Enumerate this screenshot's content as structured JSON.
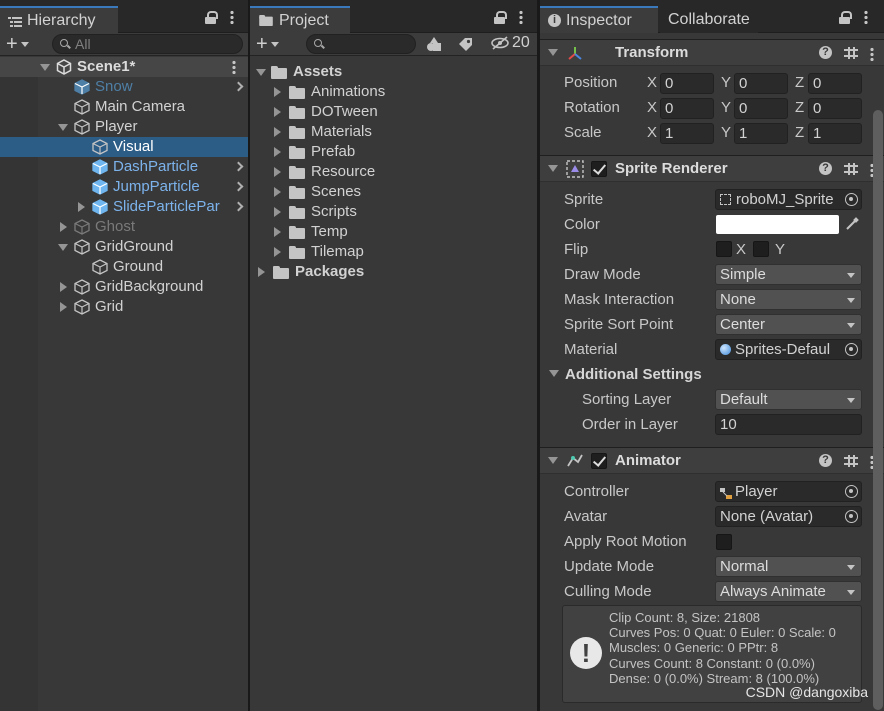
{
  "hierarchy": {
    "tab_label": "Hierarchy",
    "search_placeholder": "All",
    "items": [
      {
        "label": "Scene1*",
        "color": "#dcdcdc"
      },
      {
        "label": "Snow",
        "color": "#4e7fa6"
      },
      {
        "label": "Main Camera",
        "color": "#d2d2d2"
      },
      {
        "label": "Player",
        "color": "#d2d2d2"
      },
      {
        "label": "Visual",
        "color": "#ffffff"
      },
      {
        "label": "DashParticle",
        "color": "#7cb3ec"
      },
      {
        "label": "JumpParticle",
        "color": "#7cb3ec"
      },
      {
        "label": "SlideParticlePar",
        "color": "#7cb3ec"
      },
      {
        "label": "Ghost",
        "color": "#7a7a7a"
      },
      {
        "label": "GridGround",
        "color": "#d2d2d2"
      },
      {
        "label": "Ground",
        "color": "#d2d2d2"
      },
      {
        "label": "GridBackground",
        "color": "#d2d2d2"
      },
      {
        "label": "Grid",
        "color": "#d2d2d2"
      }
    ]
  },
  "project": {
    "tab_label": "Project",
    "hidden_count": "20",
    "root": "Assets",
    "folders": [
      "Animations",
      "DOTween",
      "Materials",
      "Prefab",
      "Resource",
      "Scenes",
      "Scripts",
      "Temp",
      "Tilemap"
    ],
    "packages": "Packages"
  },
  "inspector": {
    "tab_label": "Inspector",
    "tab2_label": "Collaborate",
    "transform": {
      "title": "Transform",
      "rows": [
        {
          "label": "Position",
          "x": "0",
          "y": "0",
          "z": "0"
        },
        {
          "label": "Rotation",
          "x": "0",
          "y": "0",
          "z": "0"
        },
        {
          "label": "Scale",
          "x": "1",
          "y": "1",
          "z": "1"
        }
      ],
      "axis_x": "X",
      "axis_y": "Y",
      "axis_z": "Z"
    },
    "sprite_renderer": {
      "title": "Sprite Renderer",
      "sprite_label": "Sprite",
      "sprite_value": "roboMJ_Sprite",
      "color_label": "Color",
      "flip_label": "Flip",
      "flip_x": "X",
      "flip_y": "Y",
      "draw_mode_label": "Draw Mode",
      "draw_mode_value": "Simple",
      "mask_label": "Mask Interaction",
      "mask_value": "None",
      "sort_point_label": "Sprite Sort Point",
      "sort_point_value": "Center",
      "material_label": "Material",
      "material_value": "Sprites-Defaul",
      "additional_label": "Additional Settings",
      "sorting_layer_label": "Sorting Layer",
      "sorting_layer_value": "Default",
      "order_label": "Order in Layer",
      "order_value": "10"
    },
    "animator": {
      "title": "Animator",
      "controller_label": "Controller",
      "controller_value": "Player",
      "avatar_label": "Avatar",
      "avatar_value": "None (Avatar)",
      "root_motion_label": "Apply Root Motion",
      "update_label": "Update Mode",
      "update_value": "Normal",
      "culling_label": "Culling Mode",
      "culling_value": "Always Animate",
      "info": "Clip Count: 8, Size: 21808\nCurves Pos: 0 Quat: 0 Euler: 0 Scale: 0\nMuscles: 0 Generic: 0 PPtr: 8\nCurves Count: 8 Constant: 0 (0.0%)\nDense: 0 (0.0%) Stream: 8 (100.0%)"
    }
  },
  "watermark": "CSDN @dangoxiba",
  "colors": {
    "selection": "#2c5d87",
    "tab_accent": "#3a79bb",
    "panel": "#383838"
  }
}
